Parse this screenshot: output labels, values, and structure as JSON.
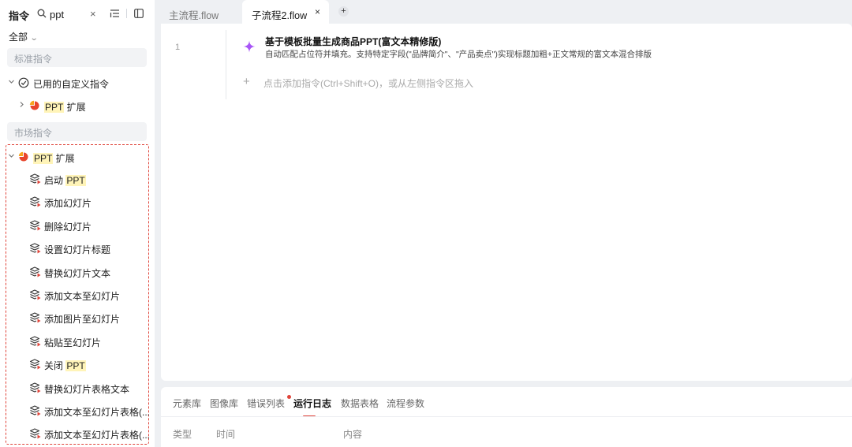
{
  "left_panel": {
    "title": "指令",
    "search_value": "ppt",
    "clear_glyph": "×",
    "filter_label": "全部",
    "standard_section": "标准指令",
    "custom_group": {
      "label": "已用的自定义指令",
      "child": {
        "label": "PPT",
        "label_suffix": " 扩展"
      }
    },
    "market_section": "市场指令",
    "market_group": {
      "label": "PPT",
      "label_suffix": " 扩展",
      "commands": [
        {
          "prefix": "启动 ",
          "highlight": "PPT"
        },
        {
          "prefix": "添加幻灯片",
          "highlight": ""
        },
        {
          "prefix": "删除幻灯片",
          "highlight": ""
        },
        {
          "prefix": "设置幻灯片标题",
          "highlight": ""
        },
        {
          "prefix": "替换幻灯片文本",
          "highlight": ""
        },
        {
          "prefix": "添加文本至幻灯片",
          "highlight": ""
        },
        {
          "prefix": "添加图片至幻灯片",
          "highlight": ""
        },
        {
          "prefix": "粘贴至幻灯片",
          "highlight": ""
        },
        {
          "prefix": "关闭 ",
          "highlight": "PPT"
        },
        {
          "prefix": "替换幻灯片表格文本",
          "highlight": ""
        },
        {
          "prefix": "添加文本至幻灯片表格(...",
          "highlight": ""
        },
        {
          "prefix": "添加文本至幻灯片表格(...",
          "highlight": ""
        }
      ]
    }
  },
  "tabs": [
    {
      "label": "主流程.flow",
      "active": false
    },
    {
      "label": "子流程2.flow",
      "active": true
    }
  ],
  "tab_close_glyph": "×",
  "tab_add_glyph": "+",
  "editor": {
    "line_number": "1",
    "step_title": "基于模板批量生成商品PPT(富文本精修版)",
    "step_desc": "自动匹配占位符并填充。支持特定字段(\"品牌简介\"、\"产品卖点\")实现标题加粗+正文常规的富文本混合排版",
    "add_plus": "+",
    "add_hint": "点击添加指令(Ctrl+Shift+O)，或从左侧指令区拖入"
  },
  "bottom_panel": {
    "tabs": [
      "元素库",
      "图像库",
      "错误列表",
      "运行日志",
      "数据表格",
      "流程参数"
    ],
    "active_tab": "运行日志",
    "columns": [
      "类型",
      "时间",
      "内容"
    ]
  },
  "colors": {
    "accent_red": "#e0443a",
    "highlight_yellow": "#fff4b8",
    "step_icon_purple": "#a855f7"
  },
  "icons": [
    "search-icon",
    "sort-icon",
    "panel-toggle-icon",
    "check-circle-icon",
    "ppt-extension-icon",
    "command-layers-icon",
    "sparkle-icon",
    "chevron-down-icon",
    "chevron-right-icon"
  ]
}
